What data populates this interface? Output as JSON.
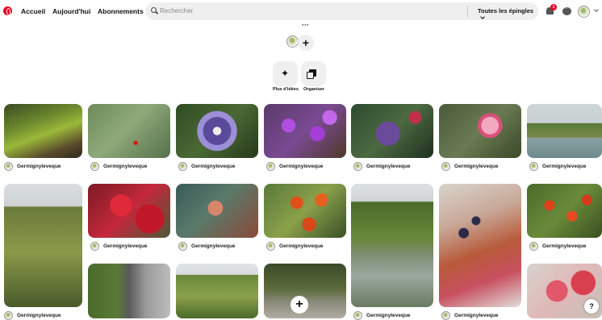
{
  "header": {
    "nav": [
      "Accueil",
      "Aujourd'hui",
      "Abonnements"
    ],
    "search_placeholder": "Rechercher",
    "filter_label": "Toutes les épingles",
    "notification_count": "1"
  },
  "board": {
    "more_label": "···",
    "add_label": "+",
    "actions": [
      {
        "label": "Plus d'idées",
        "icon": "sparkle-icon"
      },
      {
        "label": "Organiser",
        "icon": "organize-icon"
      }
    ]
  },
  "pins": [
    {
      "author": "Germignyleveque",
      "subject": "mushrooms on mossy log"
    },
    {
      "author": "Germignyleveque",
      "subject": "red berry on branch"
    },
    {
      "author": "Germignyleveque",
      "subject": "passion flower"
    },
    {
      "author": "Germignyleveque",
      "subject": "purple beautyberry"
    },
    {
      "author": "Germignyleveque",
      "subject": "purple flowers"
    },
    {
      "author": "Germignyleveque",
      "subject": "pink flower bud"
    },
    {
      "author": "Germignyleveque",
      "subject": "river landscape"
    },
    {
      "author": "Germignyleveque",
      "subject": "autumn tree"
    },
    {
      "author": "Germignyleveque",
      "subject": "red leaves"
    },
    {
      "author": "Germignyleveque",
      "subject": "butterfly"
    },
    {
      "author": "Germignyleveque",
      "subject": "chinese lanterns"
    },
    {
      "author": "Germignyleveque",
      "subject": "river with reflections"
    },
    {
      "author": "Germignyleveque",
      "subject": "virginia creeper berries"
    },
    {
      "author": "Germignyleveque",
      "subject": "red rowan berries"
    },
    {
      "author": "Germignyleveque",
      "subject": "garden statue"
    },
    {
      "author": "Germignyleveque",
      "subject": "green trees"
    },
    {
      "author": "Germignyleveque",
      "subject": "seedhead"
    },
    {
      "author": "Germignyleveque",
      "subject": "red creeper leaves"
    }
  ],
  "help_label": "?"
}
